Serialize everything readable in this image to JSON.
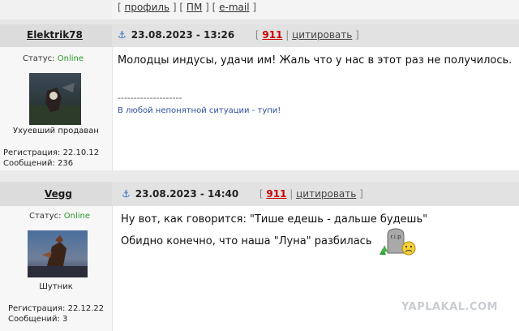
{
  "top_links": {
    "open": "[ ",
    "profile": "профиль",
    "sep1": " ] [ ",
    "pm": "ПМ",
    "sep2": " ] [ ",
    "email": "e-mail",
    "close": " ]"
  },
  "posts": [
    {
      "username": "Elektrik78",
      "date": "23.08.2023 - 13:26",
      "post_number": "911",
      "cite_label": "цитировать",
      "status_label": "Статус: ",
      "status_value": "Online",
      "rank": "Ухуевший продаван",
      "reg": "Регистрация: 22.10.12",
      "posts_count": "Сообщений: 236",
      "message_lines": [
        "Молодцы индусы, удачи им! Жаль что у нас в этот раз не получилось."
      ],
      "signature_sep": "--------------------",
      "signature": "В любой непонятной ситуации - тупи!"
    },
    {
      "username": "Vegg",
      "date": "23.08.2023 - 14:40",
      "post_number": "911",
      "cite_label": "цитировать",
      "status_label": "Статус: ",
      "status_value": "Online",
      "rank": "Шутник",
      "reg": "Регистрация: 22.12.22",
      "posts_count": "Сообщений: 3",
      "message_lines": [
        "Ну вот, как говорится: \"Тише едешь - дальше будешь\"",
        "Обидно конечно, что наша \"Луна\" разбилась"
      ],
      "smiley_text": "r.i.p"
    }
  ],
  "watermark": "YAPLAKAL.COM",
  "colors": {
    "accent": "#c00000",
    "online": "#2a9a2a",
    "signature": "#2e4f9a",
    "anchor": "#2a6cc2"
  }
}
